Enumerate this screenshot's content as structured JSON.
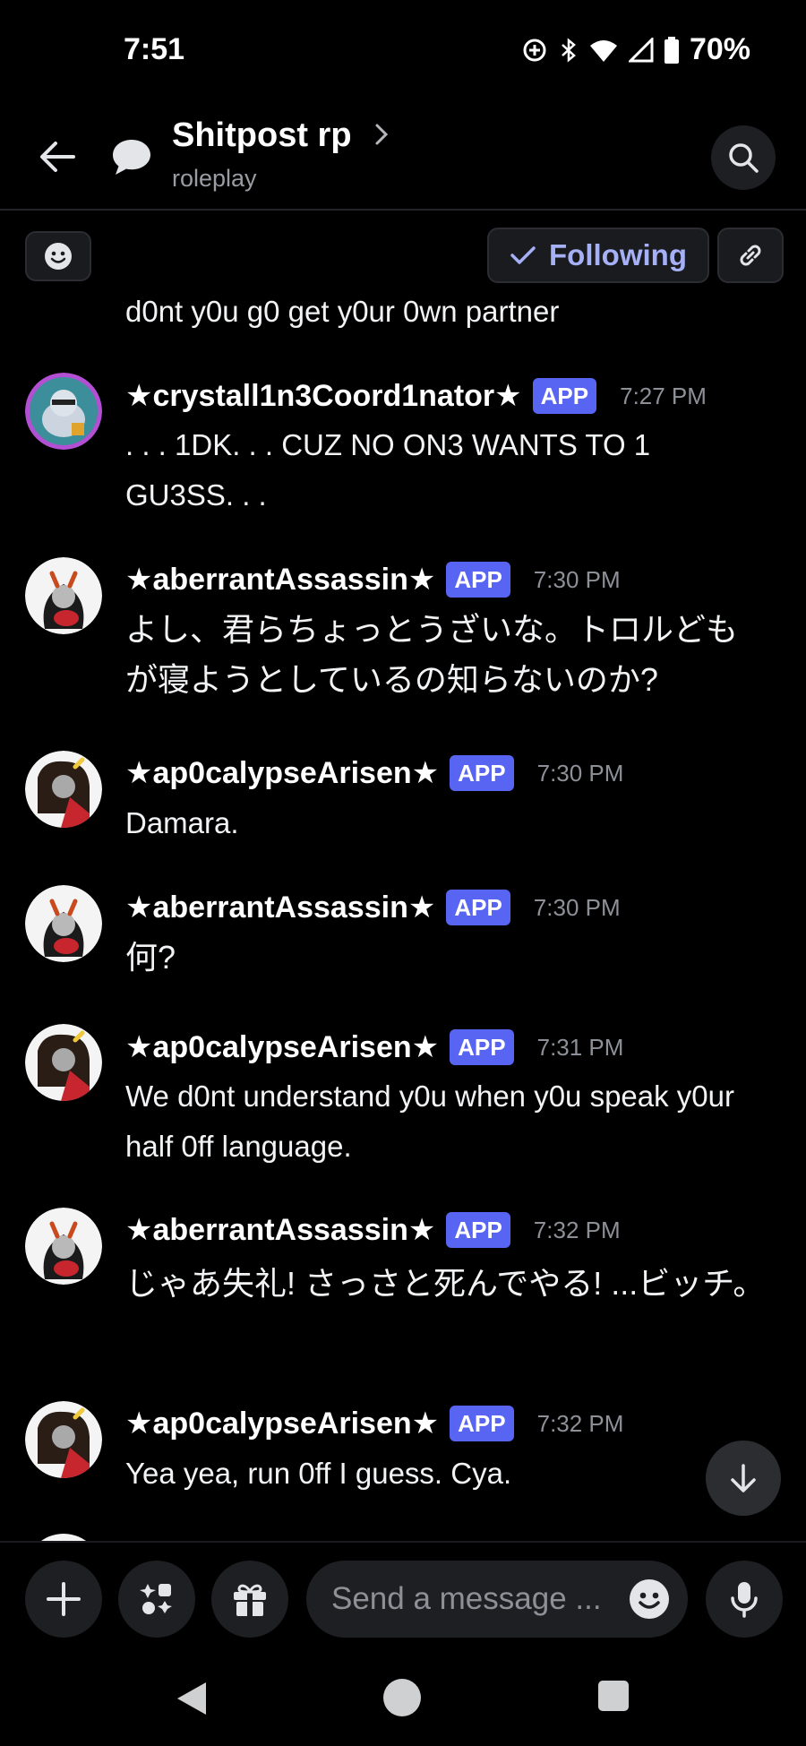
{
  "status_bar": {
    "time": "7:51",
    "battery": "70%"
  },
  "header": {
    "title": "Shitpost rp",
    "subtitle": "roleplay"
  },
  "actions": {
    "following_label": "Following"
  },
  "messages": [
    {
      "text": "d0nt y0u g0 get y0ur 0wn partner"
    },
    {
      "author": "★crystall1n3Coord1nator★",
      "badge": "APP",
      "time": "7:27 PM",
      "text": ". . . 1DK. . . CUZ NO ON3 WANTS TO 1 GU3SS. . ."
    },
    {
      "author": "★aberrantAssassin★",
      "badge": "APP",
      "time": "7:30 PM",
      "text": "よし、君らちょっとうざいな。トロルどもが寝ようとしているの知らないのか?"
    },
    {
      "author": "★ap0calypseArisen★",
      "badge": "APP",
      "time": "7:30 PM",
      "text": "Damara."
    },
    {
      "author": "★aberrantAssassin★",
      "badge": "APP",
      "time": "7:30 PM",
      "text": "何?"
    },
    {
      "author": "★ap0calypseArisen★",
      "badge": "APP",
      "time": "7:31 PM",
      "text": "We d0nt understand y0u when y0u speak y0ur half 0ff language."
    },
    {
      "author": "★aberrantAssassin★",
      "badge": "APP",
      "time": "7:32 PM",
      "text": "じゃあ失礼! さっさと死んでやる! ...ビッチ。"
    },
    {
      "author": "★ap0calypseArisen★",
      "badge": "APP",
      "time": "7:32 PM",
      "text": "Yea yea, run 0ff I guess. Cya."
    }
  ],
  "composer": {
    "placeholder": "Send a message ..."
  },
  "colors": {
    "background": "#000000",
    "accent": "#5865f2",
    "following_text": "#a5b0f6",
    "timestamp": "#8e9098"
  },
  "icons": [
    "back-arrow-icon",
    "thread-icon",
    "chevron-right-icon",
    "search-icon",
    "emoji-icon",
    "check-icon",
    "link-icon",
    "arrow-down-icon",
    "plus-icon",
    "apps-icon",
    "gift-icon",
    "microphone-icon"
  ]
}
